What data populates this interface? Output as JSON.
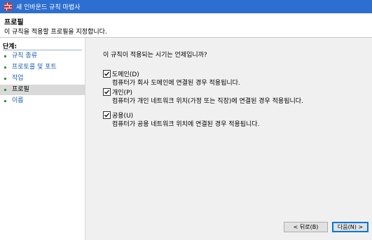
{
  "window": {
    "title": "새 인바운드 규칙 마법사"
  },
  "header": {
    "title": "프로필",
    "description": "이 규칙을 적용할 프로필을 지정합니다."
  },
  "sidebar": {
    "title": "단계:",
    "items": [
      {
        "label": "규칙 종류"
      },
      {
        "label": "프로토콜 및 포트"
      },
      {
        "label": "작업"
      },
      {
        "label": "프로필"
      },
      {
        "label": "이름"
      }
    ]
  },
  "main": {
    "question": "이 규칙이 적용되는 시기는 언제입니까?",
    "options": [
      {
        "label": "도메인(D)",
        "description": "컴퓨터가 회사 도메인에 연결된 경우 적용됩니다.",
        "checked": true
      },
      {
        "label": "개인(P)",
        "description": "컴퓨터가 개인 네트워크 위치(가정 또는 직장)에 연결된 경우 적용됩니다.",
        "checked": true
      },
      {
        "label": "공용(U)",
        "description": "컴퓨터가 공용 네트워크 위치에 연결된 경우 적용됩니다.",
        "checked": true
      }
    ]
  },
  "buttons": {
    "back": "< 뒤로(B)",
    "next": "다음(N) >"
  },
  "colors": {
    "titlebar": "#2d6fd0",
    "link": "#1a5fb4",
    "step_bullet": "#2c9c3a",
    "content_bg": "#f0f0f0"
  },
  "icons": {
    "window": "firewall-icon",
    "checkbox": "checkmark-icon"
  }
}
